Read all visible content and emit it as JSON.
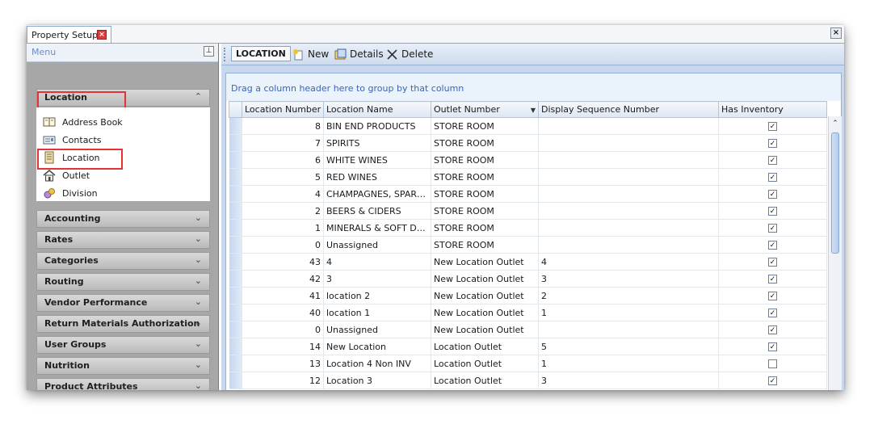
{
  "tab": {
    "title": "Property Setup"
  },
  "menu": {
    "header": "Menu",
    "expanded_group": "Location",
    "items": [
      {
        "label": "Address Book",
        "icon": "address-book-icon"
      },
      {
        "label": "Contacts",
        "icon": "contacts-icon"
      },
      {
        "label": "Location",
        "icon": "location-icon"
      },
      {
        "label": "Outlet",
        "icon": "home-icon"
      },
      {
        "label": "Division",
        "icon": "division-icon"
      }
    ],
    "groups": [
      "Accounting",
      "Rates",
      "Categories",
      "Routing",
      "Vendor Performance",
      "Return Materials Authorization",
      "User Groups",
      "Nutrition",
      "Product Attributes"
    ]
  },
  "toolbar": {
    "title": "LOCATION",
    "new_label": "New",
    "details_label": "Details",
    "delete_label": "Delete"
  },
  "grid": {
    "group_panel_text": "Drag a column header here to group by that column",
    "columns": [
      "Location Number",
      "Location Name",
      "Outlet Number",
      "Display Sequence Number",
      "Has Inventory"
    ],
    "rows": [
      {
        "number": "8",
        "name": "BIN END PRODUCTS",
        "outlet": "STORE ROOM",
        "seq": "",
        "inventory": true
      },
      {
        "number": "7",
        "name": "SPIRITS",
        "outlet": "STORE ROOM",
        "seq": "",
        "inventory": true
      },
      {
        "number": "6",
        "name": "WHITE WINES",
        "outlet": "STORE ROOM",
        "seq": "",
        "inventory": true
      },
      {
        "number": "5",
        "name": "RED WINES",
        "outlet": "STORE ROOM",
        "seq": "",
        "inventory": true
      },
      {
        "number": "4",
        "name": "CHAMPAGNES, SPARKLING",
        "outlet": "STORE ROOM",
        "seq": "",
        "inventory": true
      },
      {
        "number": "2",
        "name": "BEERS & CIDERS",
        "outlet": "STORE ROOM",
        "seq": "",
        "inventory": true
      },
      {
        "number": "1",
        "name": "MINERALS & SOFT DRINKS",
        "outlet": "STORE ROOM",
        "seq": "",
        "inventory": true
      },
      {
        "number": "0",
        "name": "Unassigned",
        "outlet": "STORE ROOM",
        "seq": "",
        "inventory": true
      },
      {
        "number": "43",
        "name": "4",
        "outlet": "New Location Outlet",
        "seq": "4",
        "inventory": true
      },
      {
        "number": "42",
        "name": "3",
        "outlet": "New Location Outlet",
        "seq": "3",
        "inventory": true
      },
      {
        "number": "41",
        "name": "location 2",
        "outlet": "New Location Outlet",
        "seq": "2",
        "inventory": true
      },
      {
        "number": "40",
        "name": "location 1",
        "outlet": "New Location Outlet",
        "seq": "1",
        "inventory": true
      },
      {
        "number": "0",
        "name": "Unassigned",
        "outlet": "New Location Outlet",
        "seq": "",
        "inventory": true
      },
      {
        "number": "14",
        "name": "New Location",
        "outlet": "Location Outlet",
        "seq": "5",
        "inventory": true
      },
      {
        "number": "13",
        "name": "Location 4 Non INV",
        "outlet": "Location Outlet",
        "seq": "1",
        "inventory": false
      },
      {
        "number": "12",
        "name": "Location 3",
        "outlet": "Location Outlet",
        "seq": "3",
        "inventory": true
      }
    ]
  }
}
